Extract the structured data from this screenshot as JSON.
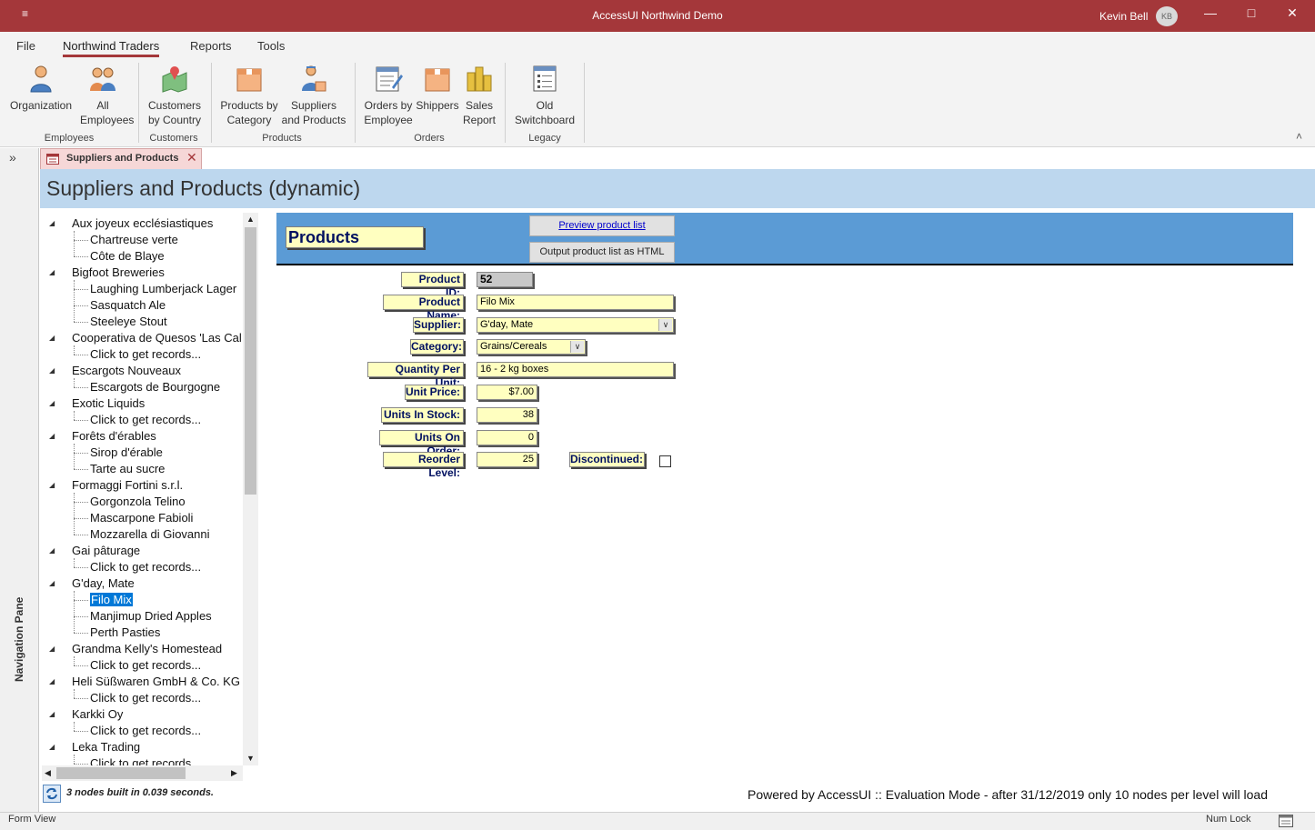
{
  "window": {
    "title": "AccessUI Northwind Demo",
    "quick_access": "≡",
    "user_name": "Kevin Bell",
    "user_initials": "KB",
    "minimize": "—",
    "maximize": "□",
    "close": "✕"
  },
  "menu": {
    "tabs": [
      "File",
      "Northwind Traders",
      "Reports",
      "Tools"
    ]
  },
  "ribbon": {
    "buttons": [
      {
        "label1": "Organization",
        "label2": ""
      },
      {
        "label1": "All",
        "label2": "Employees"
      },
      {
        "label1": "Customers",
        "label2": "by Country"
      },
      {
        "label1": "Products by",
        "label2": "Category"
      },
      {
        "label1": "Suppliers",
        "label2": "and Products"
      },
      {
        "label1": "Orders by",
        "label2": "Employee"
      },
      {
        "label1": "Shippers",
        "label2": ""
      },
      {
        "label1": "Sales",
        "label2": "Report"
      },
      {
        "label1": "Old",
        "label2": "Switchboard"
      }
    ],
    "groups": [
      "Employees",
      "Customers",
      "Products",
      "Orders",
      "Legacy"
    ],
    "collapse": "˄"
  },
  "nav_pane": {
    "label": "Navigation Pane",
    "toggle": "»"
  },
  "document_tab": {
    "label": "Suppliers and Products",
    "close": "✕"
  },
  "form_header": {
    "title": "Suppliers and Products (dynamic)"
  },
  "tree": {
    "nodes": [
      {
        "level": 0,
        "text": "Aux joyeux ecclésiastiques"
      },
      {
        "level": 1,
        "text": "Chartreuse verte"
      },
      {
        "level": 1,
        "text": "Côte de Blaye"
      },
      {
        "level": 0,
        "text": "Bigfoot Breweries"
      },
      {
        "level": 1,
        "text": "Laughing Lumberjack Lager"
      },
      {
        "level": 1,
        "text": "Sasquatch Ale"
      },
      {
        "level": 1,
        "text": "Steeleye Stout"
      },
      {
        "level": 0,
        "text": "Cooperativa de Quesos 'Las Cal"
      },
      {
        "level": 1,
        "text": "Click to get records..."
      },
      {
        "level": 0,
        "text": "Escargots Nouveaux"
      },
      {
        "level": 1,
        "text": "Escargots de Bourgogne"
      },
      {
        "level": 0,
        "text": "Exotic Liquids"
      },
      {
        "level": 1,
        "text": "Click to get records..."
      },
      {
        "level": 0,
        "text": "Forêts d'érables"
      },
      {
        "level": 1,
        "text": "Sirop d'érable"
      },
      {
        "level": 1,
        "text": "Tarte au sucre"
      },
      {
        "level": 0,
        "text": "Formaggi Fortini s.r.l."
      },
      {
        "level": 1,
        "text": "Gorgonzola Telino"
      },
      {
        "level": 1,
        "text": "Mascarpone Fabioli"
      },
      {
        "level": 1,
        "text": "Mozzarella di Giovanni"
      },
      {
        "level": 0,
        "text": "Gai pâturage"
      },
      {
        "level": 1,
        "text": "Click to get records..."
      },
      {
        "level": 0,
        "text": "G'day, Mate"
      },
      {
        "level": 1,
        "text": "Filo Mix",
        "selected": true
      },
      {
        "level": 1,
        "text": "Manjimup Dried Apples"
      },
      {
        "level": 1,
        "text": "Perth Pasties"
      },
      {
        "level": 0,
        "text": "Grandma Kelly's Homestead"
      },
      {
        "level": 1,
        "text": "Click to get records..."
      },
      {
        "level": 0,
        "text": "Heli Süßwaren GmbH & Co. KG"
      },
      {
        "level": 1,
        "text": "Click to get records..."
      },
      {
        "level": 0,
        "text": "Karkki Oy"
      },
      {
        "level": 1,
        "text": "Click to get records..."
      },
      {
        "level": 0,
        "text": "Leka Trading"
      },
      {
        "level": 1,
        "text": "Click to get records..."
      }
    ],
    "status": "3 nodes built in 0.039 seconds.",
    "scroll_up": "▲",
    "scroll_down": "▼",
    "scroll_left": "◀",
    "scroll_right": "▶"
  },
  "product_form": {
    "title": "Products",
    "preview_button": "Preview product list",
    "output_button": "Output product list as HTML",
    "fields": {
      "product_id": {
        "label": "Product ID:",
        "value": "52"
      },
      "product_name": {
        "label": "Product Name:",
        "value": "Filo Mix"
      },
      "supplier": {
        "label": "Supplier:",
        "value": "G'day, Mate"
      },
      "category": {
        "label": "Category:",
        "value": "Grains/Cereals"
      },
      "quantity_per_unit": {
        "label": "Quantity Per Unit:",
        "value": "16 - 2 kg boxes"
      },
      "unit_price": {
        "label": "Unit Price:",
        "value": "$7.00"
      },
      "units_in_stock": {
        "label": "Units In Stock:",
        "value": "38"
      },
      "units_on_order": {
        "label": "Units On Order:",
        "value": "0"
      },
      "reorder_level": {
        "label": "Reorder Level:",
        "value": "25"
      },
      "discontinued": {
        "label": "Discontinued:",
        "checked": false
      }
    },
    "dropdown_glyph": "∨"
  },
  "footer_note": "Powered by AccessUI :: Evaluation Mode - after 31/12/2019 only 10 nodes per level will load",
  "statusbar": {
    "left": "Form View",
    "num_lock": "Num Lock"
  },
  "colors": {
    "accent": "#a4373a",
    "form_header_band": "#bdd7ee",
    "products_band": "#5b9bd5",
    "field_fill": "#ffffc0",
    "selection": "#0078d7"
  }
}
